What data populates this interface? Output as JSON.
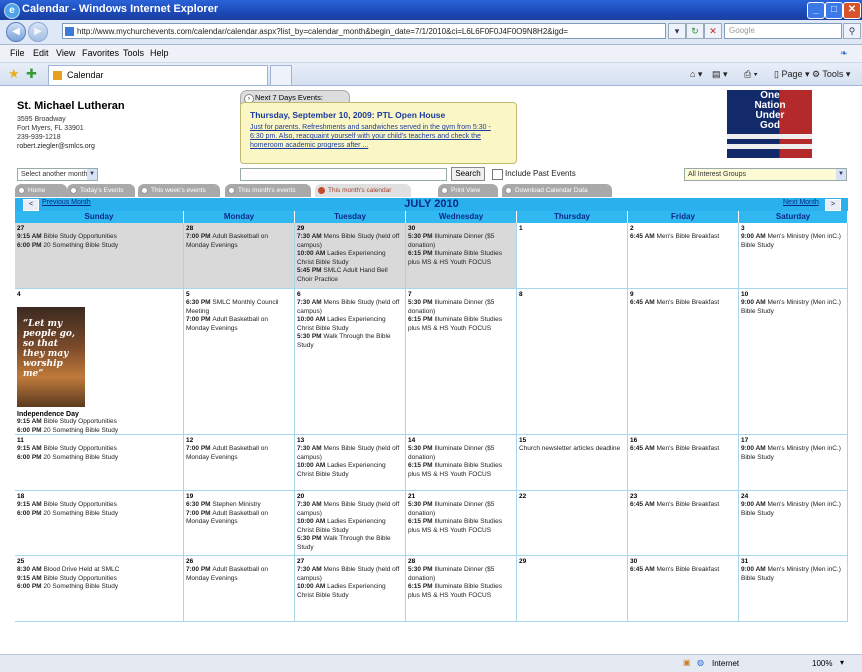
{
  "window": {
    "title": "Calendar - Windows Internet Explorer"
  },
  "address": {
    "url": "http://www.mychurchevents.com/calendar/calendar.aspx?list_by=calendar_month&begin_date=7/1/2010&ci=L6L6F0F0J4F0O9N8H2&igd=",
    "search_placeholder": "Google"
  },
  "menu": [
    "File",
    "Edit",
    "View",
    "Favorites",
    "Tools",
    "Help"
  ],
  "tab": {
    "label": "Calendar"
  },
  "toolbar": {
    "page": "Page",
    "tools": "Tools"
  },
  "org": {
    "name": "St. Michael Lutheran",
    "address1": "3595 Broadway",
    "address2": "Fort Myers, FL 33901",
    "phone": "239-939-1218",
    "email": "robert.ziegler@smlcs.org"
  },
  "next7": {
    "header": "Next 7 Days Events:",
    "event_title": "Thursday, September 10, 2009: PTL Open House",
    "event_desc": "Just for parents. Refreshments and sandwiches served in the gym from 5:30 - 6:30 pm. Also, reacquaint yourself with your child's teachers and check the homeroom academic progress after ..."
  },
  "logo": {
    "text": "One Nation Under God"
  },
  "controls": {
    "month_select": "Select another month",
    "search_btn": "Search",
    "include_past": "Include Past Events",
    "interest_select": "All Interest Groups"
  },
  "navtabs": [
    "Home",
    "Today's Events",
    "This week's events",
    "This month's events",
    "This month's calendar",
    "Print View",
    "Download Calendar Data"
  ],
  "calendar": {
    "title": "JULY 2010",
    "prev": "Previous Month",
    "next": "Next Month",
    "days": [
      "Sunday",
      "Monday",
      "Tuesday",
      "Wednesday",
      "Thursday",
      "Friday",
      "Saturday"
    ],
    "weeks": [
      [
        {
          "d": "27",
          "past": true,
          "ev": [
            [
              "9:15 AM",
              "Bible Study Opportunities"
            ],
            [
              "6:00 PM",
              "20 Something Bible Study"
            ]
          ]
        },
        {
          "d": "28",
          "past": true,
          "ev": [
            [
              "7:00 PM",
              "Adult Basketball on Monday Evenings"
            ]
          ]
        },
        {
          "d": "29",
          "past": true,
          "ev": [
            [
              "7:30 AM",
              "Mens Bible Study (held off campus)"
            ],
            [
              "10:00 AM",
              "Ladies Experiencing Christ Bible Study"
            ],
            [
              "5:45 PM",
              "SMLC Adult Hand Bell Choir Practice"
            ]
          ]
        },
        {
          "d": "30",
          "past": true,
          "ev": [
            [
              "5:30 PM",
              "Illuminate Dinner ($5 donation)"
            ],
            [
              "6:15 PM",
              "Illuminate Bible Studies plus MS & HS Youth FOCUS"
            ]
          ]
        },
        {
          "d": "1",
          "ev": []
        },
        {
          "d": "2",
          "ev": [
            [
              "6:45 AM",
              "Men's Bible Breakfast"
            ]
          ]
        },
        {
          "d": "3",
          "ev": [
            [
              "9:00 AM",
              "Men's Ministry (Men inC.) Bible Study"
            ]
          ]
        }
      ],
      [
        {
          "d": "4",
          "poster": "“Let my people go, so that they may worship me”",
          "holiday": "Independence Day",
          "ev": [
            [
              "9:15 AM",
              "Bible Study Opportunities"
            ],
            [
              "6:00 PM",
              "20 Something Bible Study"
            ]
          ]
        },
        {
          "d": "5",
          "ev": [
            [
              "6:30 PM",
              "SMLC Monthly Council Meeting"
            ],
            [
              "7:00 PM",
              "Adult Basketball on Monday Evenings"
            ]
          ]
        },
        {
          "d": "6",
          "ev": [
            [
              "7:30 AM",
              "Mens Bible Study (held off campus)"
            ],
            [
              "10:00 AM",
              "Ladies Experiencing Christ Bible Study"
            ],
            [
              "5:30 PM",
              "Walk Through the Bible Study"
            ]
          ]
        },
        {
          "d": "7",
          "ev": [
            [
              "5:30 PM",
              "Illuminate Dinner ($5 donation)"
            ],
            [
              "6:15 PM",
              "Illuminate Bible Studies plus MS & HS Youth FOCUS"
            ]
          ]
        },
        {
          "d": "8",
          "ev": []
        },
        {
          "d": "9",
          "ev": [
            [
              "6:45 AM",
              "Men's Bible Breakfast"
            ]
          ]
        },
        {
          "d": "10",
          "ev": [
            [
              "9:00 AM",
              "Men's Ministry (Men inC.) Bible Study"
            ]
          ]
        }
      ],
      [
        {
          "d": "11",
          "ev": [
            [
              "9:15 AM",
              "Bible Study Opportunities"
            ],
            [
              "6:00 PM",
              "20 Something Bible Study"
            ]
          ]
        },
        {
          "d": "12",
          "ev": [
            [
              "7:00 PM",
              "Adult Basketball on Monday Evenings"
            ]
          ]
        },
        {
          "d": "13",
          "ev": [
            [
              "7:30 AM",
              "Mens Bible Study (held off campus)"
            ],
            [
              "10:00 AM",
              "Ladies Experiencing Christ Bible Study"
            ]
          ]
        },
        {
          "d": "14",
          "ev": [
            [
              "5:30 PM",
              "Illuminate Dinner ($5 donation)"
            ],
            [
              "6:15 PM",
              "Illuminate Bible Studies plus MS & HS Youth FOCUS"
            ]
          ]
        },
        {
          "d": "15",
          "ev": [
            [
              "",
              "Church newsletter articles deadline"
            ]
          ]
        },
        {
          "d": "16",
          "ev": [
            [
              "6:45 AM",
              "Men's Bible Breakfast"
            ]
          ]
        },
        {
          "d": "17",
          "ev": [
            [
              "9:00 AM",
              "Men's Ministry (Men inC.) Bible Study"
            ]
          ]
        }
      ],
      [
        {
          "d": "18",
          "ev": [
            [
              "9:15 AM",
              "Bible Study Opportunities"
            ],
            [
              "6:00 PM",
              "20 Something Bible Study"
            ]
          ]
        },
        {
          "d": "19",
          "ev": [
            [
              "6:30 PM",
              "Stephen Ministry"
            ],
            [
              "7:00 PM",
              "Adult Basketball on Monday Evenings"
            ]
          ]
        },
        {
          "d": "20",
          "ev": [
            [
              "7:30 AM",
              "Mens Bible Study (held off campus)"
            ],
            [
              "10:00 AM",
              "Ladies Experiencing Christ Bible Study"
            ],
            [
              "5:30 PM",
              "Walk Through the Bible Study"
            ]
          ]
        },
        {
          "d": "21",
          "ev": [
            [
              "5:30 PM",
              "Illuminate Dinner ($5 donation)"
            ],
            [
              "6:15 PM",
              "Illuminate Bible Studies plus MS & HS Youth FOCUS"
            ]
          ]
        },
        {
          "d": "22",
          "ev": []
        },
        {
          "d": "23",
          "ev": [
            [
              "6:45 AM",
              "Men's Bible Breakfast"
            ]
          ]
        },
        {
          "d": "24",
          "ev": [
            [
              "9:00 AM",
              "Men's Ministry (Men inC.) Bible Study"
            ]
          ]
        }
      ],
      [
        {
          "d": "25",
          "ev": [
            [
              "8:30 AM",
              "Blood Drive Held at SMLC"
            ],
            [
              "9:15 AM",
              "Bible Study Opportunities"
            ],
            [
              "6:00 PM",
              "20 Something Bible Study"
            ]
          ]
        },
        {
          "d": "26",
          "ev": [
            [
              "7:00 PM",
              "Adult Basketball on Monday Evenings"
            ]
          ]
        },
        {
          "d": "27",
          "ev": [
            [
              "7:30 AM",
              "Mens Bible Study (held off campus)"
            ],
            [
              "10:00 AM",
              "Ladies Experiencing Christ Bible Study"
            ]
          ]
        },
        {
          "d": "28",
          "ev": [
            [
              "5:30 PM",
              "Illuminate Dinner ($5 donation)"
            ],
            [
              "6:15 PM",
              "Illuminate Bible Studies plus MS & HS Youth FOCUS"
            ]
          ]
        },
        {
          "d": "29",
          "ev": []
        },
        {
          "d": "30",
          "ev": [
            [
              "6:45 AM",
              "Men's Bible Breakfast"
            ]
          ]
        },
        {
          "d": "31",
          "ev": [
            [
              "9:00 AM",
              "Men's Ministry (Men inC.) Bible Study"
            ]
          ]
        }
      ]
    ]
  },
  "status": {
    "zone": "Internet",
    "zoom": "100%"
  }
}
